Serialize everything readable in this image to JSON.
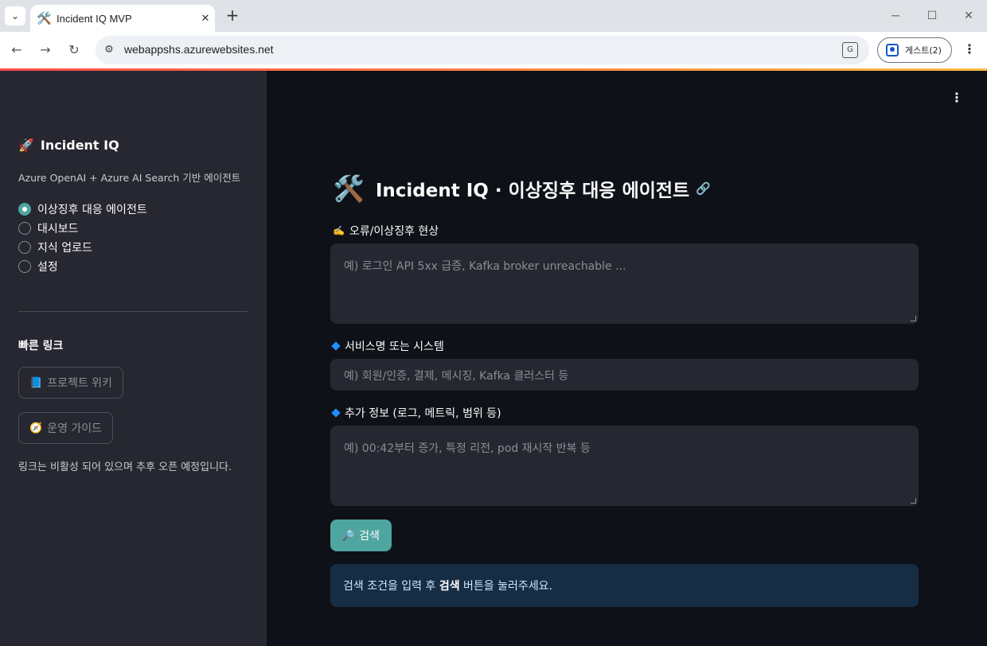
{
  "browser": {
    "tab_favicon": "🛠️",
    "tab_title": "Incident IQ MVP",
    "tab_close": "✕",
    "new_tab": "+",
    "url": "webappshs.azurewebsites.net",
    "profile_label": "게스트(2)",
    "controls": {
      "minimize": "─",
      "maximize": "☐",
      "close": "✕"
    }
  },
  "sidebar": {
    "app_emoji": "🚀",
    "app_title": "Incident IQ",
    "subtitle": "Azure OpenAI + Azure AI Search 기반 에이전트",
    "nav_options": [
      {
        "label": "이상징후 대응 에이전트",
        "selected": true
      },
      {
        "label": "대시보드",
        "selected": false
      },
      {
        "label": "지식 업로드",
        "selected": false
      },
      {
        "label": "설정",
        "selected": false
      }
    ],
    "quick_links_heading": "빠른 링크",
    "links": [
      {
        "emoji": "📘",
        "label": "프로젝트 위키"
      },
      {
        "emoji": "🧭",
        "label": "운영 가이드"
      }
    ],
    "note": "링크는 비활성 되어 있으며 추후 오픈 예정입니다."
  },
  "main": {
    "title_emoji": "🛠️",
    "title": "Incident IQ · 이상징후 대응 에이전트",
    "symptom": {
      "emoji": "✍️",
      "label": "오류/이상징후 현상",
      "placeholder": "예) 로그인 API 5xx 급증, Kafka broker unreachable ..."
    },
    "service": {
      "label": "서비스명 또는 시스템",
      "placeholder": "예) 회원/인증, 결제, 메시징, Kafka 클러스터 등"
    },
    "extra": {
      "label": "추가 정보 (로그, 메트릭, 범위 등)",
      "placeholder": "예) 00:42부터 증가, 특정 리전, pod 재시작 반복 등"
    },
    "search_button": {
      "emoji": "🔎",
      "label": "검색"
    },
    "info": {
      "prefix": "검색 조건을 입력 후 ",
      "bold": "검색",
      "suffix": " 버튼을 눌러주세요."
    }
  },
  "colors": {
    "accent": "#4fa5a0",
    "sidebar_bg": "#262730",
    "main_bg": "#0e1117",
    "info_bg": "#172d43"
  }
}
